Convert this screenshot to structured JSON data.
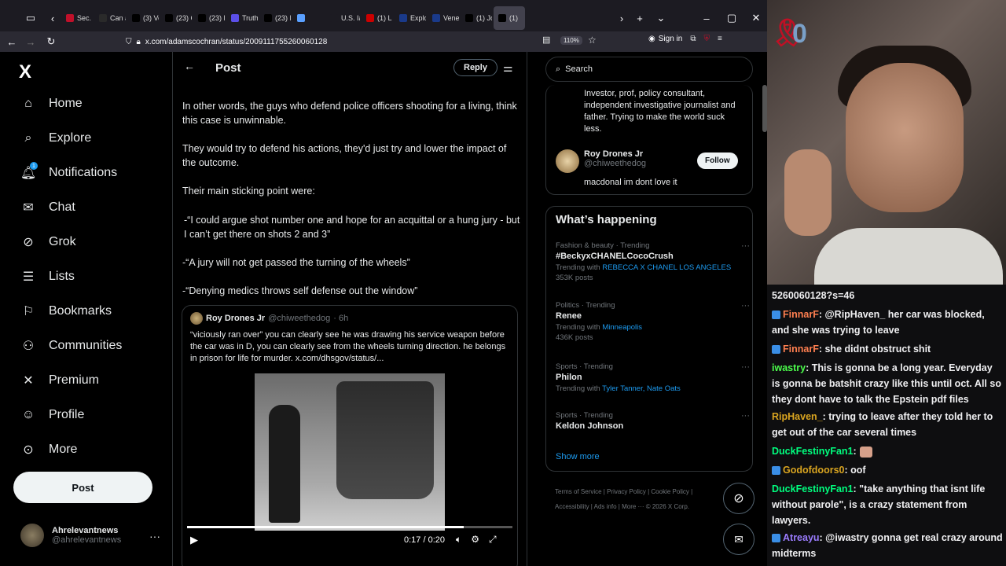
{
  "browser": {
    "tabs": [
      "Sec. 1",
      "Can a",
      "(3) Ve",
      "(23) C",
      "(23) M",
      "Truth",
      "(23) M",
      "",
      "U.S. Ia",
      "(1) L",
      "Explo",
      "Venez",
      "(1) Jo",
      "(1)"
    ],
    "url": "x.com/adamscochran/status/2009111755260060128",
    "zoom": "110%",
    "signin": "Sign in"
  },
  "xnav": {
    "logo": "X",
    "items": [
      "Home",
      "Explore",
      "Notifications",
      "Chat",
      "Grok",
      "Lists",
      "Bookmarks",
      "Communities",
      "Premium",
      "Profile",
      "More"
    ],
    "notif_badge": "1",
    "post_label": "Post",
    "account_name": "Ahrelevantnews",
    "account_handle": "@ahrelevantnews"
  },
  "main": {
    "title": "Post",
    "reply_label": "Reply",
    "paragraphs": [
      "In other words, the guys who defend police officers shooting for a living, think this case is unwinnable.",
      "They would try to defend his actions, they'd just try and lower the impact of the outcome.",
      "Their main sticking point were:",
      "-“I could argue shot number one and hope for an acquittal or a hung jury - but I can’t get there on shots 2 and 3”",
      "-“A jury will not get passed the turning of the wheels”",
      "-“Denying medics throws self defense out the window”"
    ],
    "quote": {
      "name": "Roy Drones Jr",
      "handle": "@chiweethedog",
      "time": "· 6h",
      "text": "“viciously ran over” you can clearly see he was drawing his service weapon before the car was in D, you can clearly see from the wheels turning direction. he belongs in prison for life for murder.  x.com/dhsgov/status/..."
    },
    "video": {
      "time": "0:17 / 0:20",
      "progress": 0.85
    }
  },
  "right": {
    "search_placeholder": "Search",
    "bio": "Investor, prof, policy consultant, independent investigative journalist and father. Trying to make the world suck less.",
    "follow_name": "Roy Drones Jr",
    "follow_handle": "@chiweethedog",
    "follow_desc": "macdonal im dont love it",
    "follow_label": "Follow",
    "whats_happening": "What’s happening",
    "trends": [
      {
        "meta": "Fashion & beauty · Trending",
        "name": "#BeckyxCHANELCocoCrush",
        "with_label": "Trending with",
        "with": "REBECCA X CHANEL LOS ANGELES",
        "posts": "353K posts"
      },
      {
        "meta": "Politics · Trending",
        "name": "Renee",
        "with_label": "Trending with",
        "with": "Minneapolis",
        "posts": "436K posts"
      },
      {
        "meta": "Sports · Trending",
        "name": "Philon",
        "with_label": "Trending with",
        "with": "Tyler Tanner, Nate Oats",
        "posts": ""
      },
      {
        "meta": "Sports · Trending",
        "name": "Keldon Johnson",
        "with_label": "",
        "with": "",
        "posts": ""
      }
    ],
    "show_more": "Show more",
    "footer_row1": "Terms of Service  |  Privacy Policy  |  Cookie Policy  |",
    "footer_row2": "Accessibility  |  Ads info  |  More ···  © 2026 X Corp."
  },
  "stream": {
    "overlay_text": "0",
    "chat": [
      {
        "user": "",
        "text": "5260060128?s=46",
        "color": "#efeff1",
        "icon": false
      },
      {
        "user": "FinnarF",
        "text": ": @RipHaven_ her car was blocked, and she was trying to leave",
        "color": "#ff7f50",
        "icon": true
      },
      {
        "user": "FinnarF",
        "text": ": she didnt obstruct shit",
        "color": "#ff7f50",
        "icon": true
      },
      {
        "user": "iwastry",
        "text": ": This is gonna be a long year. Everyday is gonna be batshit crazy like this until oct. All so they dont have to talk the Epstein pdf files",
        "color": "#4cff4c",
        "icon": false
      },
      {
        "user": "RipHaven_",
        "text": ": trying to leave after they told her to get out of the car several times",
        "color": "#daa520",
        "icon": false
      },
      {
        "user": "DuckFestinyFan1",
        "text": ":",
        "color": "#00ff7f",
        "icon": false,
        "emote": true
      },
      {
        "user": "Godofdoors0",
        "text": ": oof",
        "color": "#daa520",
        "icon": true
      },
      {
        "user": "DuckFestinyFan1",
        "text": ": \"take anything that isnt life without parole\", is a crazy statement from lawyers.",
        "color": "#00ff7f",
        "icon": false
      },
      {
        "user": "Atreayu",
        "text": ": @iwastry gonna get real crazy around midterms",
        "color": "#9b7cff",
        "icon": true
      }
    ]
  }
}
